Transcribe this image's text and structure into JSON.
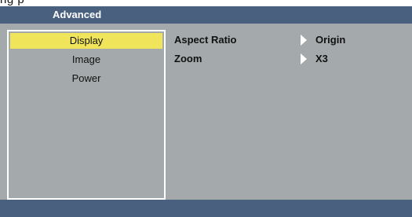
{
  "top_fragment": "ng p",
  "osd": {
    "title": "Advanced",
    "menu": [
      {
        "label": "Display",
        "selected": true
      },
      {
        "label": "Image",
        "selected": false
      },
      {
        "label": "Power",
        "selected": false
      }
    ],
    "settings": [
      {
        "label": "Aspect Ratio",
        "value": "Origin"
      },
      {
        "label": "Zoom",
        "value": "X3"
      }
    ]
  },
  "colors": {
    "title_bar": "#49617f",
    "panel_bg": "#a4a9ab",
    "selection": "#f0e55a",
    "border": "#ffffff"
  }
}
